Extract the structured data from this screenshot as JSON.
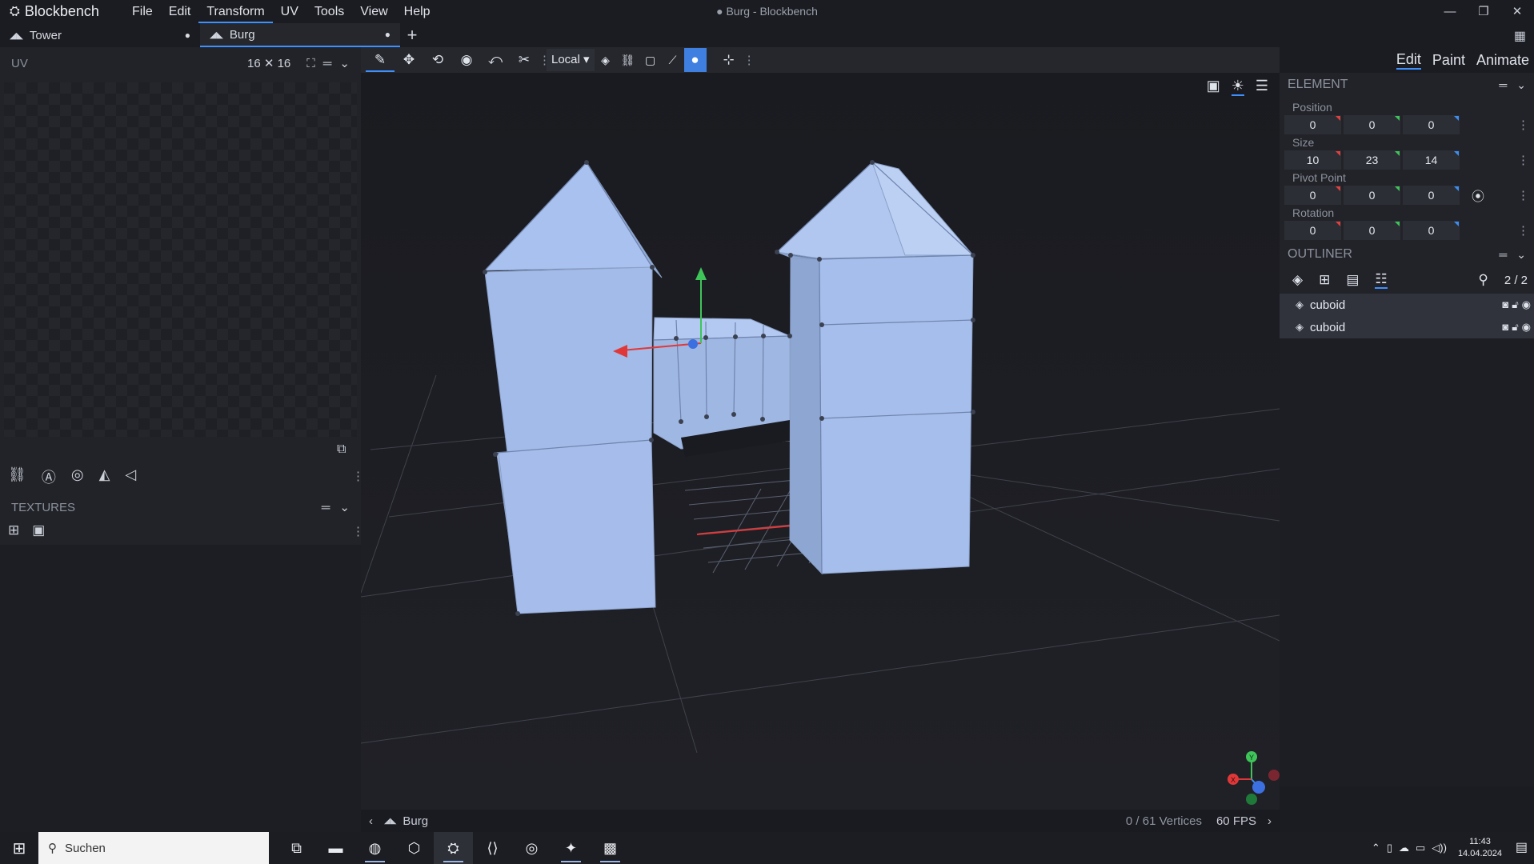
{
  "app": {
    "name": "Blockbench",
    "window_title": "● Burg - Blockbench",
    "menu": [
      "File",
      "Edit",
      "Transform",
      "UV",
      "Tools",
      "View",
      "Help"
    ],
    "active_menu": "Transform",
    "window_controls": [
      "—",
      "❐",
      "✕"
    ]
  },
  "tabs": [
    {
      "label": "Tower",
      "dot": "●"
    },
    {
      "label": "Burg",
      "dot": "●"
    }
  ],
  "uv_panel": {
    "title": "UV",
    "resolution": "16 ✕ 16"
  },
  "textures_panel": {
    "title": "TEXTURES"
  },
  "toolbar": {
    "space_select": "Local"
  },
  "modes": [
    "Edit",
    "Paint",
    "Animate"
  ],
  "element_panel": {
    "title": "ELEMENT",
    "position_label": "Position",
    "position": [
      "0",
      "0",
      "0"
    ],
    "size_label": "Size",
    "size": [
      "10",
      "23",
      "14"
    ],
    "pivot_label": "Pivot Point",
    "pivot": [
      "0",
      "0",
      "0"
    ],
    "rotation_label": "Rotation",
    "rotation": [
      "0",
      "0",
      "0"
    ]
  },
  "outliner": {
    "title": "OUTLINER",
    "count": "2 / 2",
    "items": [
      {
        "name": "cuboid"
      },
      {
        "name": "cuboid"
      }
    ]
  },
  "viewport_footer": {
    "project": "Burg",
    "vertices": "0 / 61 Vertices",
    "fps": "60 FPS"
  },
  "gizmo_axes": {
    "x": "X",
    "y": "Y"
  },
  "taskbar": {
    "search_placeholder": "Suchen",
    "time": "11:43",
    "date": "14.04.2024"
  },
  "colors": {
    "accent": "#3e90ff",
    "model_face": "#a8c0ec",
    "axis_x": "#e04040",
    "axis_y": "#3fc45a",
    "axis_z": "#3c8ef0"
  }
}
